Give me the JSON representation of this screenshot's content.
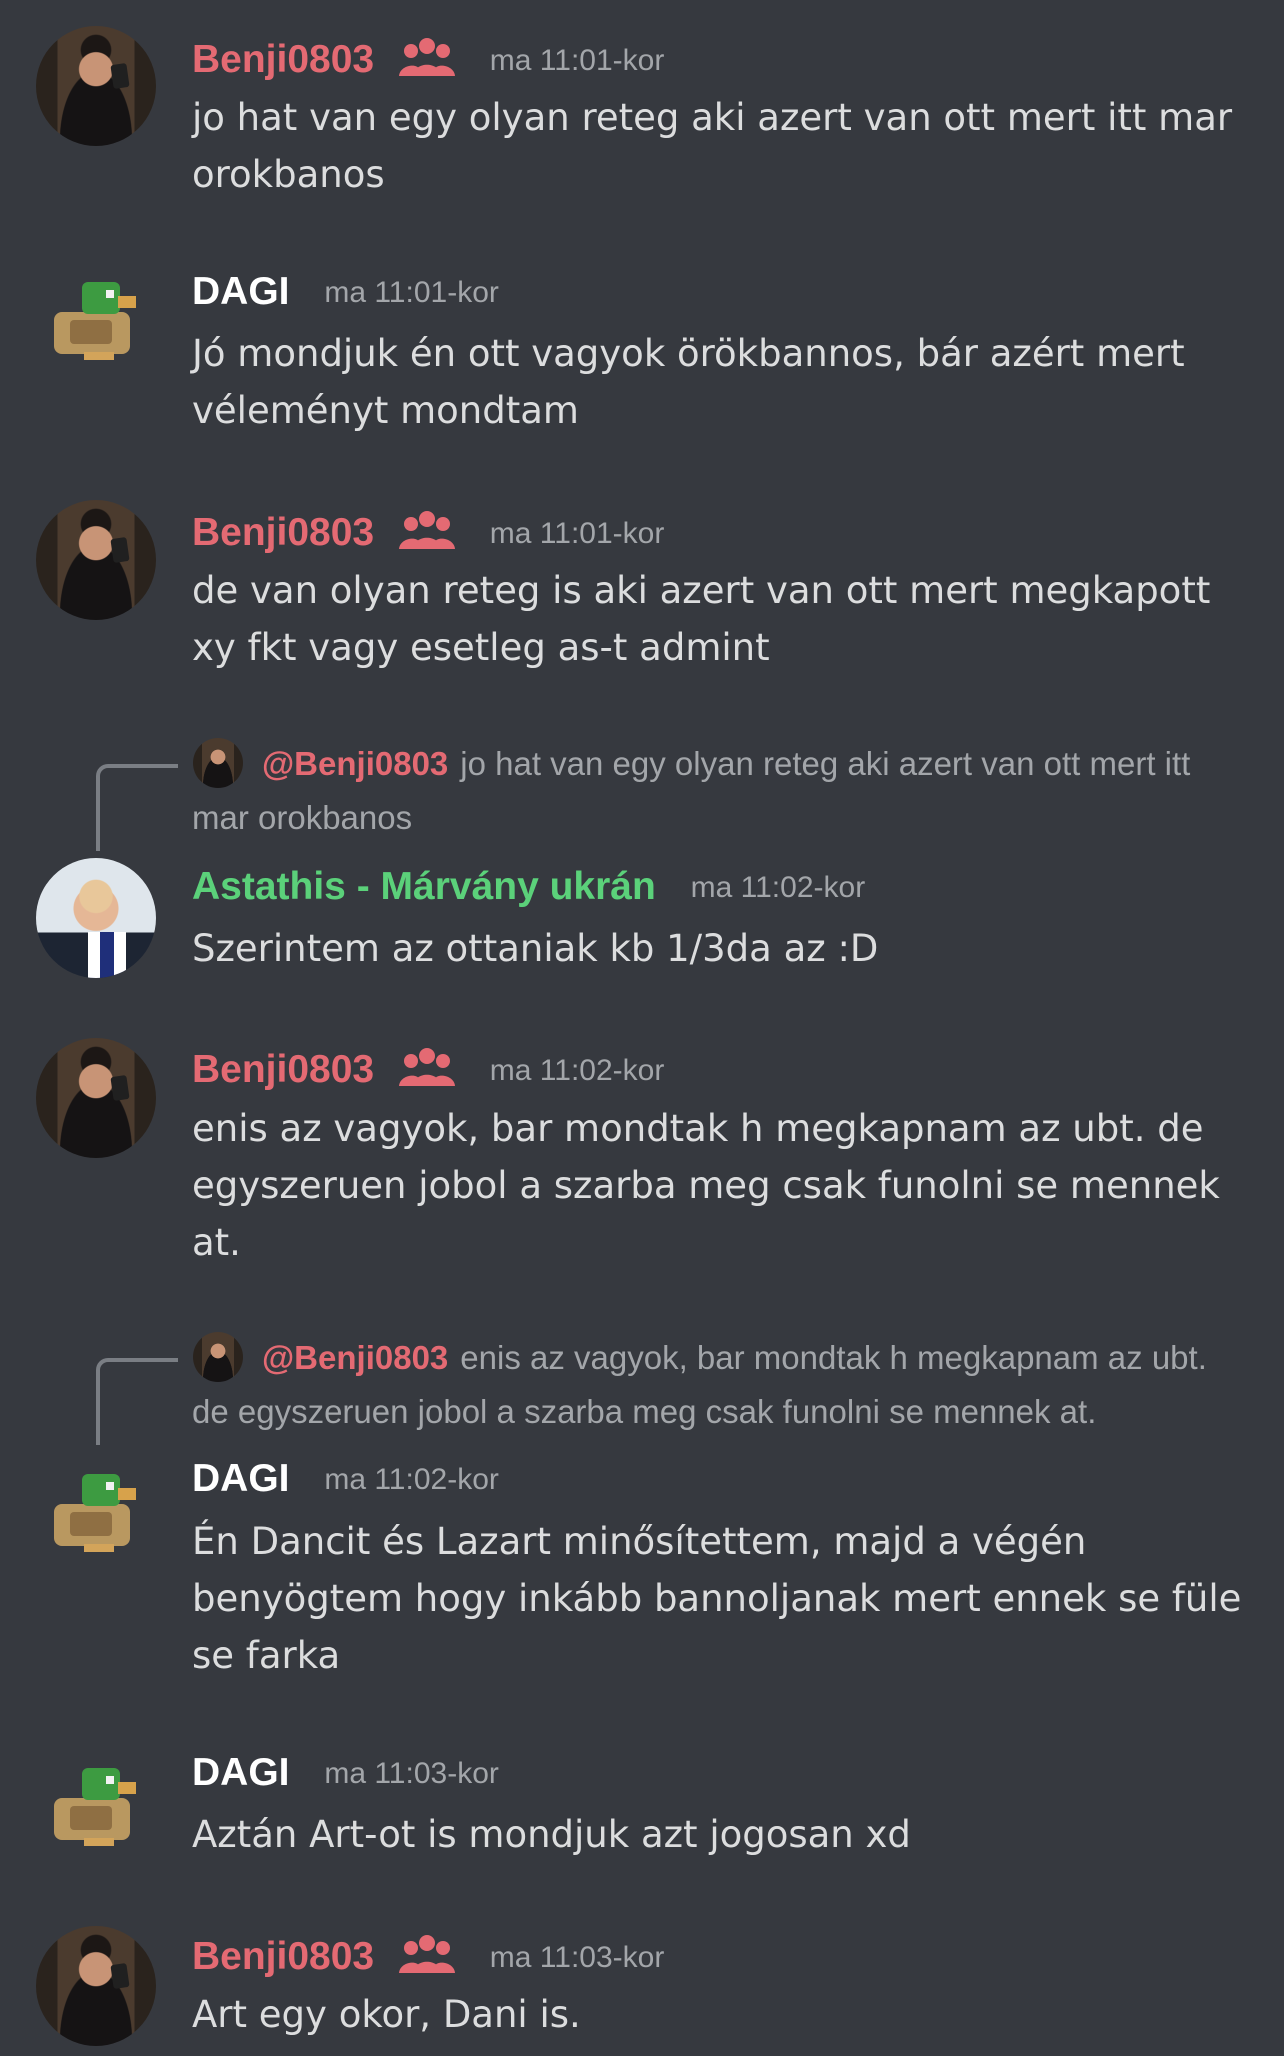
{
  "messages": [
    {
      "author": "Benji0803",
      "timestamp": "ma 11:01-kor",
      "text": "jo hat van egy olyan reteg aki azert van ott mert itt mar orokbanos"
    },
    {
      "author": "DAGI",
      "timestamp": "ma 11:01-kor",
      "text": "Jó mondjuk én ott vagyok örökbannos, bár azért mert véleményt mondtam"
    },
    {
      "author": "Benji0803",
      "timestamp": "ma 11:01-kor",
      "text": "de van olyan reteg is aki azert van ott mert megkapott xy fkt vagy esetleg as-t admint"
    },
    {
      "reply_to": "@Benji0803",
      "reply_text": "jo hat van egy olyan reteg aki azert van ott mert itt mar orokbanos",
      "author": "Astathis - Márvány ukrán",
      "timestamp": "ma 11:02-kor",
      "text": "Szerintem az ottaniak kb 1/3da az :D"
    },
    {
      "author": "Benji0803",
      "timestamp": "ma 11:02-kor",
      "text": "enis az vagyok, bar mondtak h megkapnam az ubt. de egyszeruen jobol a szarba meg csak funolni se mennek at."
    },
    {
      "reply_to": "@Benji0803",
      "reply_text": "enis az vagyok, bar mondtak h megkapnam az ubt. de egyszeruen jobol a szarba meg csak funolni se mennek at.",
      "author": "DAGI",
      "timestamp": "ma 11:02-kor",
      "text": "Én Dancit és Lazart minősítettem, majd a végén benyögtem hogy inkább bannoljanak mert ennek se füle se farka"
    },
    {
      "author": "DAGI",
      "timestamp": "ma 11:03-kor",
      "text": "Aztán Art-ot is mondjuk azt jogosan xd"
    },
    {
      "author": "Benji0803",
      "timestamp": "ma 11:03-kor",
      "text": "Art egy okor, Dani is."
    }
  ],
  "colors": {
    "background": "#36393f",
    "benji_name": "#e46a73",
    "dagi_name": "#ffffff",
    "astathis_name": "#5bd17a",
    "message_text": "#dcddde",
    "timestamp": "#a3a6aa"
  },
  "icons": {
    "group": "people-group-icon",
    "benji_avatar": "benji-avatar",
    "dagi_avatar": "duck-pixel-avatar",
    "astathis_avatar": "trump-avatar"
  }
}
